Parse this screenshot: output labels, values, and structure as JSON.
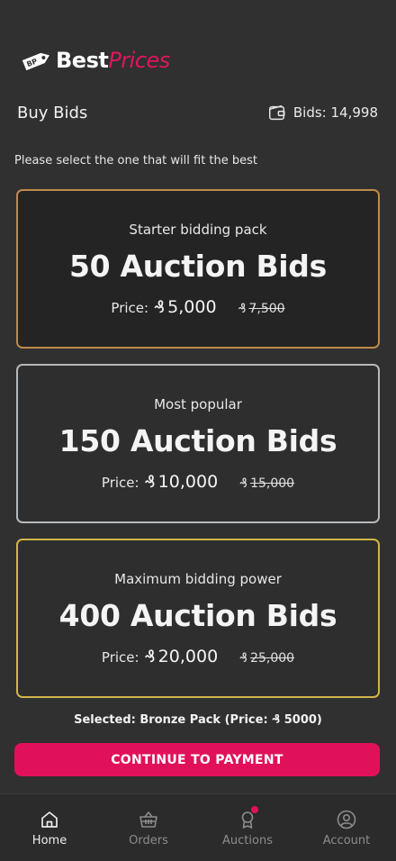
{
  "brand": {
    "name_part1": "Best",
    "name_part2": "Prices",
    "tag_text": "BP"
  },
  "header": {
    "title": "Buy Bids",
    "bids_label": "Bids: 14,998"
  },
  "subtitle": "Please select the one that will fit the best",
  "currency_symbol": "₰",
  "packs": [
    {
      "tagline": "Starter bidding pack",
      "bids": "50 Auction Bids",
      "price_label": "Price:",
      "price": "5,000",
      "old_price": "7,500",
      "border_color": "#c08a4a"
    },
    {
      "tagline": "Most popular",
      "bids": "150 Auction Bids",
      "price_label": "Price:",
      "price": "10,000",
      "old_price": "15,000",
      "border_color": "#b6b9bc"
    },
    {
      "tagline": "Maximum bidding power",
      "bids": "400 Auction Bids",
      "price_label": "Price:",
      "price": "20,000",
      "old_price": "25,000",
      "border_color": "#d2b548"
    }
  ],
  "selected_summary": "Selected: Bronze Pack (Price: ₰ 5000)",
  "continue_label": "CONTINUE TO PAYMENT",
  "accent_color": "#e0115a",
  "nav": [
    {
      "label": "Home",
      "icon": "home-icon",
      "active": true
    },
    {
      "label": "Orders",
      "icon": "basket-icon"
    },
    {
      "label": "Auctions",
      "icon": "award-icon",
      "badge": true
    },
    {
      "label": "Account",
      "icon": "account-icon"
    }
  ]
}
